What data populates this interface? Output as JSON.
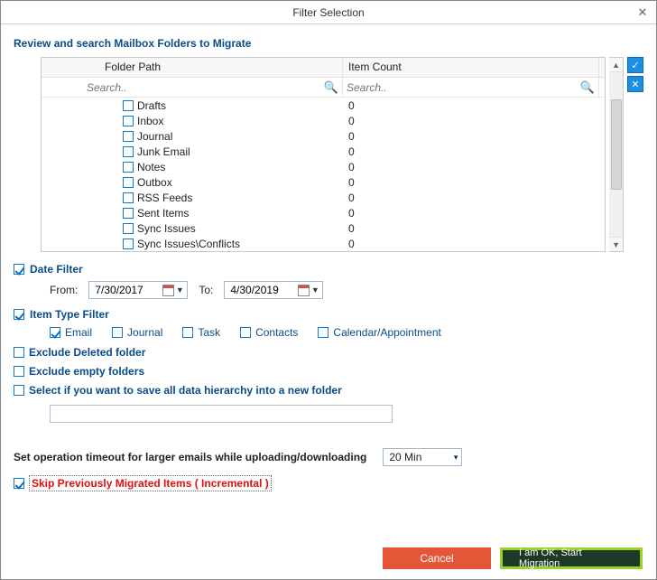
{
  "window": {
    "title": "Filter Selection"
  },
  "header": "Review and search Mailbox Folders to Migrate",
  "table": {
    "columns": {
      "path": "Folder Path",
      "count": "Item Count"
    },
    "search_placeholder": "Search..",
    "rows": [
      {
        "name": "Drafts",
        "count": "0"
      },
      {
        "name": "Inbox",
        "count": "0"
      },
      {
        "name": "Journal",
        "count": "0"
      },
      {
        "name": "Junk Email",
        "count": "0"
      },
      {
        "name": "Notes",
        "count": "0"
      },
      {
        "name": "Outbox",
        "count": "0"
      },
      {
        "name": "RSS Feeds",
        "count": "0"
      },
      {
        "name": "Sent Items",
        "count": "0"
      },
      {
        "name": "Sync Issues",
        "count": "0"
      },
      {
        "name": "Sync Issues\\Conflicts",
        "count": "0"
      }
    ]
  },
  "date_filter": {
    "label": "Date Filter",
    "from_label": "From:",
    "to_label": "To:",
    "from": "7/30/2017",
    "to": "4/30/2019"
  },
  "item_type": {
    "label": "Item Type Filter",
    "options": [
      {
        "name": "Email",
        "checked": true
      },
      {
        "name": "Journal",
        "checked": false
      },
      {
        "name": "Task",
        "checked": false
      },
      {
        "name": "Contacts",
        "checked": false
      },
      {
        "name": "Calendar/Appointment",
        "checked": false
      }
    ]
  },
  "exclude_deleted": "Exclude Deleted folder",
  "exclude_empty": "Exclude empty folders",
  "save_hierarchy": "Select if you want to save all data hierarchy into a new folder",
  "timeout": {
    "label": "Set operation timeout for larger emails while uploading/downloading",
    "value": "20 Min"
  },
  "skip_migrated": "Skip Previously Migrated Items ( Incremental )",
  "buttons": {
    "cancel": "Cancel",
    "start": "I am OK, Start Migration"
  }
}
